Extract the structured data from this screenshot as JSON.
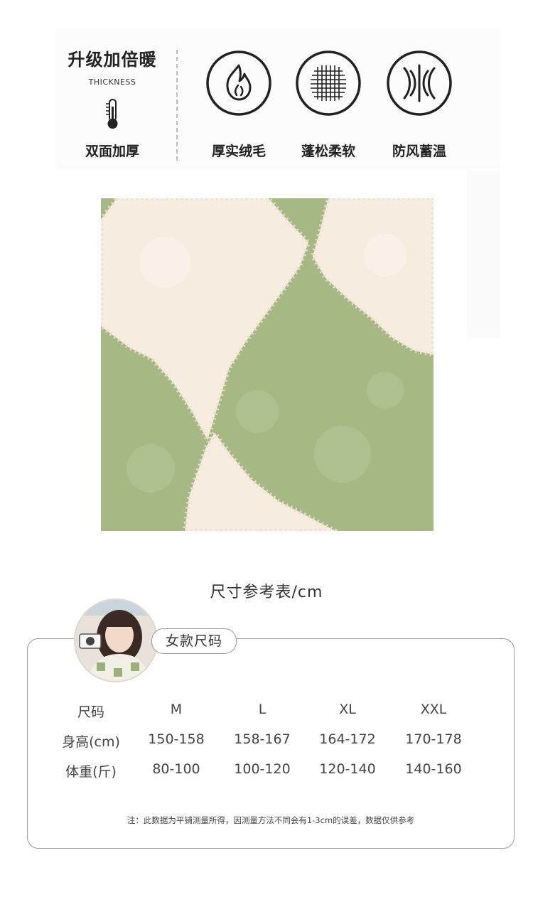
{
  "features": {
    "headline": "升级加倍暖",
    "headline_sub": "THICKNESS",
    "thickness_caption": "双面加厚",
    "items": [
      {
        "label": "厚实绒毛",
        "icon": "flame-icon"
      },
      {
        "label": "蓬松柔软",
        "icon": "fiber-mesh-icon"
      },
      {
        "label": "防风蓄温",
        "icon": "windproof-icon"
      }
    ]
  },
  "fabric": {
    "colors": {
      "green": "#a6b985",
      "cream": "#f6ece0"
    }
  },
  "size_chart": {
    "heading": "尺寸参考表/cm",
    "tag": "女款尺码",
    "rows": [
      [
        "尺码",
        "M",
        "L",
        "XL",
        "XXL"
      ],
      [
        "身高(cm)",
        "150-158",
        "158-167",
        "164-172",
        "170-178"
      ],
      [
        "体重(斤)",
        "80-100",
        "100-120",
        "120-140",
        "140-160"
      ]
    ],
    "note": "注：此数据为平铺测量所得，因测量方法不同会有1-3cm的误差，数据仅供参考"
  }
}
